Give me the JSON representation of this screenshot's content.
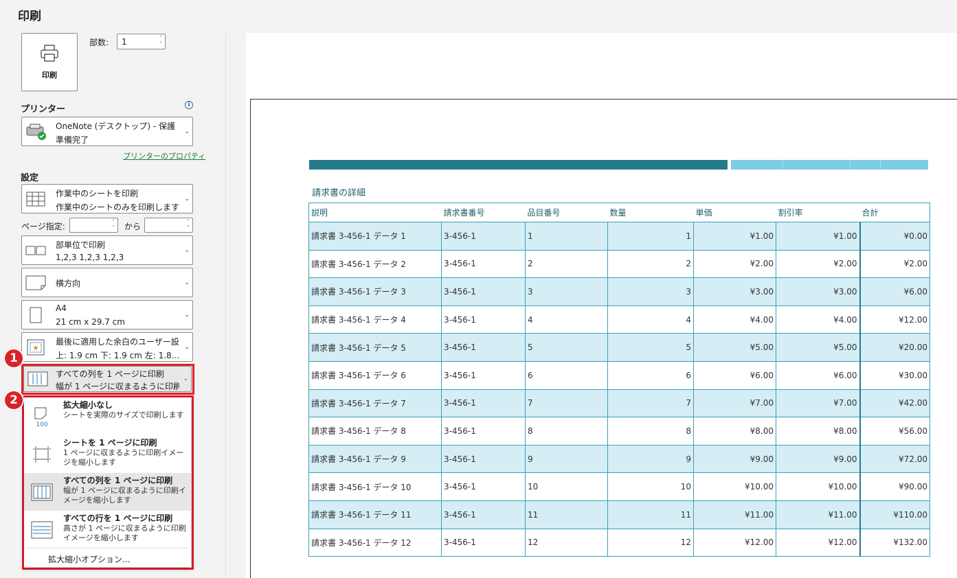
{
  "title": "印刷",
  "print_button": {
    "label": "印刷"
  },
  "copies": {
    "label": "部数:",
    "value": "1"
  },
  "printer": {
    "section_title": "プリンター",
    "name": "OneNote (デスクトップ) - 保護",
    "status": "準備完了",
    "properties_link": "プリンターのプロパティ"
  },
  "settings": {
    "section_title": "設定",
    "scope": {
      "title": "作業中のシートを印刷",
      "desc": "作業中のシートのみを印刷します"
    },
    "pages": {
      "label": "ページ指定:",
      "to_label": "から",
      "from_value": "",
      "to_value": ""
    },
    "collate": {
      "title": "部単位で印刷",
      "desc": "1,2,3    1,2,3    1,2,3"
    },
    "orientation": {
      "title": "横方向"
    },
    "paper": {
      "title": "A4",
      "desc": "21 cm x 29.7 cm"
    },
    "margins": {
      "title": "最後に適用した余白のユーザー設定",
      "desc": "上: 1.9 cm 下: 1.9 cm 左: 1.8…"
    },
    "scaling": {
      "title": "すべての列を 1 ページに印刷",
      "desc": "幅が 1 ページに収まるように印刷イ…"
    }
  },
  "badges": [
    "1",
    "2"
  ],
  "scaling_menu": {
    "items": [
      {
        "title": "拡大縮小なし",
        "desc": "シートを実際のサイズで印刷します",
        "icon": "no-scaling-icon",
        "selected": false
      },
      {
        "title": "シートを 1 ページに印刷",
        "desc": "1 ページに収まるように印刷イメージを縮小します",
        "icon": "fit-sheet-icon",
        "selected": false
      },
      {
        "title": "すべての列を 1 ページに印刷",
        "desc": "幅が 1 ページに収まるように印刷イメージを縮小します",
        "icon": "fit-columns-icon",
        "selected": true
      },
      {
        "title": "すべての行を 1 ページに印刷",
        "desc": "高さが 1 ページに収まるように印刷イメージを縮小します",
        "icon": "fit-rows-icon",
        "selected": false
      }
    ],
    "options_label": "拡大縮小オプション..."
  },
  "preview": {
    "doc_title": "請求書の詳細",
    "bar_colors": {
      "dark": "#247b8c",
      "light": "#7ccde3"
    },
    "columns": [
      "説明",
      "請求書番号",
      "品目番号",
      "数量",
      "単価",
      "割引率",
      "合計"
    ],
    "rows": [
      [
        "請求書 3-456-1 データ 1",
        "3-456-1",
        "1",
        "1",
        "¥1.00",
        "¥1.00",
        "¥0.00"
      ],
      [
        "請求書 3-456-1 データ 2",
        "3-456-1",
        "2",
        "2",
        "¥2.00",
        "¥2.00",
        "¥2.00"
      ],
      [
        "請求書 3-456-1 データ 3",
        "3-456-1",
        "3",
        "3",
        "¥3.00",
        "¥3.00",
        "¥6.00"
      ],
      [
        "請求書 3-456-1 データ 4",
        "3-456-1",
        "4",
        "4",
        "¥4.00",
        "¥4.00",
        "¥12.00"
      ],
      [
        "請求書 3-456-1 データ 5",
        "3-456-1",
        "5",
        "5",
        "¥5.00",
        "¥5.00",
        "¥20.00"
      ],
      [
        "請求書 3-456-1 データ 6",
        "3-456-1",
        "6",
        "6",
        "¥6.00",
        "¥6.00",
        "¥30.00"
      ],
      [
        "請求書 3-456-1 データ 7",
        "3-456-1",
        "7",
        "7",
        "¥7.00",
        "¥7.00",
        "¥42.00"
      ],
      [
        "請求書 3-456-1 データ 8",
        "3-456-1",
        "8",
        "8",
        "¥8.00",
        "¥8.00",
        "¥56.00"
      ],
      [
        "請求書 3-456-1 データ 9",
        "3-456-1",
        "9",
        "9",
        "¥9.00",
        "¥9.00",
        "¥72.00"
      ],
      [
        "請求書 3-456-1 データ 10",
        "3-456-1",
        "10",
        "10",
        "¥10.00",
        "¥10.00",
        "¥90.00"
      ],
      [
        "請求書 3-456-1 データ 11",
        "3-456-1",
        "11",
        "11",
        "¥11.00",
        "¥11.00",
        "¥110.00"
      ],
      [
        "請求書 3-456-1 データ 12",
        "3-456-1",
        "12",
        "12",
        "¥12.00",
        "¥12.00",
        "¥132.00"
      ]
    ]
  }
}
